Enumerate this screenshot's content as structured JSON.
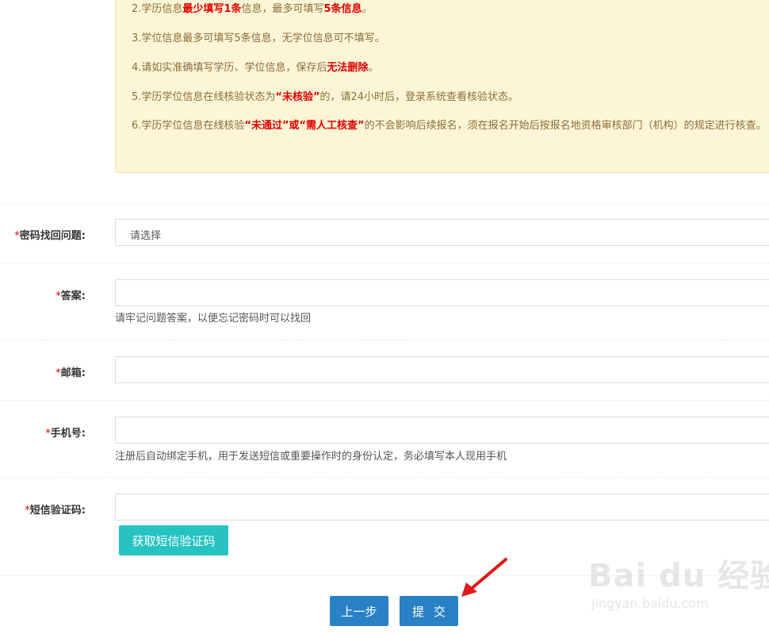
{
  "notice": {
    "item2": {
      "prefix": "2.学历信息",
      "bold1": "最少填写1条",
      "mid": "信息，最多可填写",
      "bold2": "5条信息",
      "suffix": "。"
    },
    "item3": "3.学位信息最多可填写5条信息，无学位信息可不填写。",
    "item4": {
      "prefix": "4.请如实准确填写学历、学位信息，保存后",
      "bold": "无法删除",
      "suffix": "。"
    },
    "item5": {
      "prefix": "5.学历学位信息在线核验状态为",
      "bold": "“未核验”",
      "suffix": "的，请24小时后，登录系统查看核验状态。"
    },
    "item6": {
      "prefix": "6.学历学位信息在线核验",
      "bold": "“未通过”或“需人工核查”",
      "suffix": "的不会影响后续报名，须在报名开始后按报名地资格审核部门（机构）的规定进行核查。"
    }
  },
  "form": {
    "required_mark": "*",
    "security_question": {
      "label": "密码找回问题:",
      "value": "请选择"
    },
    "answer": {
      "label": "答案:",
      "value": "",
      "hint": "请牢记问题答案，以便忘记密码时可以找回"
    },
    "email": {
      "label": "邮箱:",
      "value": ""
    },
    "phone": {
      "label": "手机号:",
      "value": "",
      "hint": "注册后自动绑定手机，用于发送短信或重要操作时的身份认定，务必填写本人现用手机"
    },
    "sms_code": {
      "label": "短信验证码:",
      "value": "",
      "button": "获取短信验证码"
    }
  },
  "actions": {
    "prev": "上一步",
    "submit": "提交"
  },
  "watermark": {
    "brand": "Bai du 经验",
    "url": "jingyan.baidu.com"
  },
  "colors": {
    "accent_blue": "#2a82c6",
    "teal": "#27c3c1",
    "required_red": "#e00000",
    "notice_bg": "#fdf6d6"
  }
}
